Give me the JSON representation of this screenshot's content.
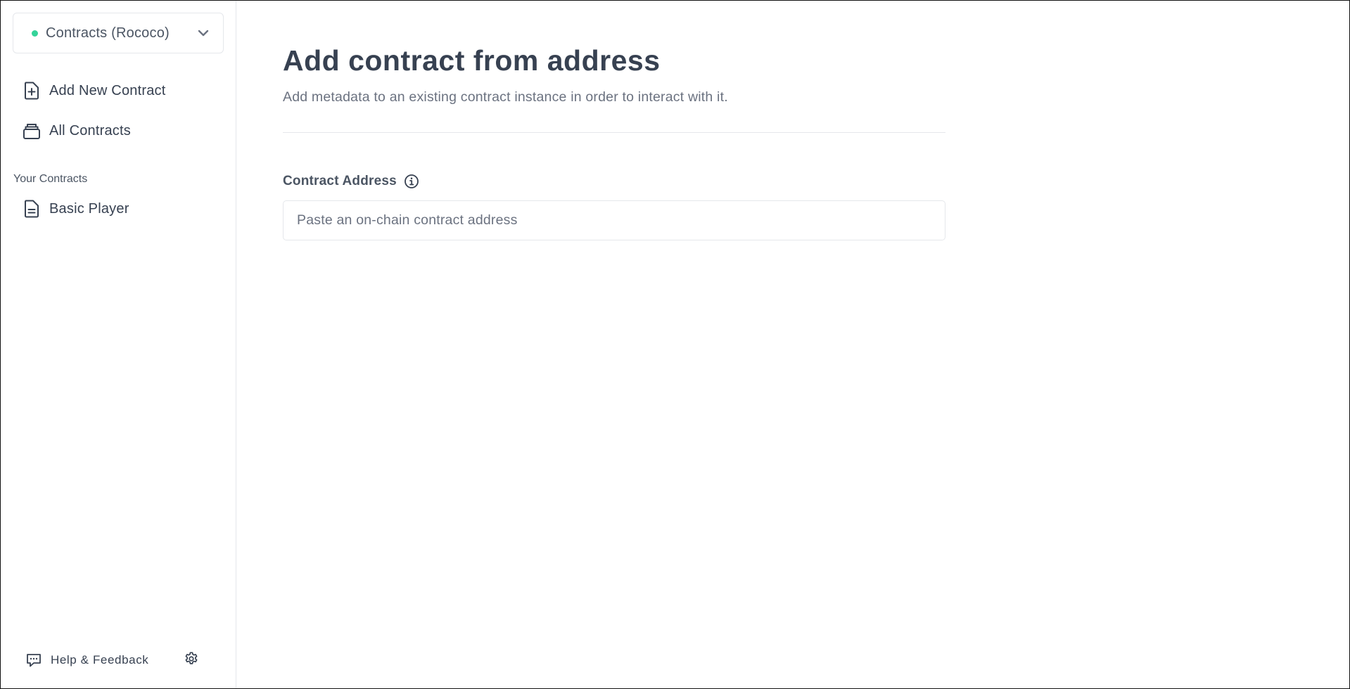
{
  "theme": {
    "status_dot_color": "#34d399",
    "text_primary": "#374151",
    "text_muted": "#6b7280",
    "border": "#e5e7eb"
  },
  "sidebar": {
    "network_selector": {
      "label": "Contracts (Rococo)",
      "status": "connected",
      "icon": "chevron-down-icon"
    },
    "nav": [
      {
        "label": "Add New Contract",
        "icon": "file-plus-icon"
      },
      {
        "label": "All Contracts",
        "icon": "stack-icon"
      }
    ],
    "your_contracts_title": "Your Contracts",
    "contracts": [
      {
        "label": "Basic Player",
        "icon": "document-icon"
      }
    ],
    "footer": {
      "help_label": "Help & Feedback",
      "help_icon": "chat-icon",
      "settings_icon": "gear-icon"
    }
  },
  "main": {
    "title": "Add contract from address",
    "subtitle": "Add metadata to an existing contract instance in order to interact with it.",
    "address_field": {
      "label": "Contract Address",
      "info_icon": "info-icon",
      "value": "",
      "placeholder": "Paste an on-chain contract address"
    }
  }
}
